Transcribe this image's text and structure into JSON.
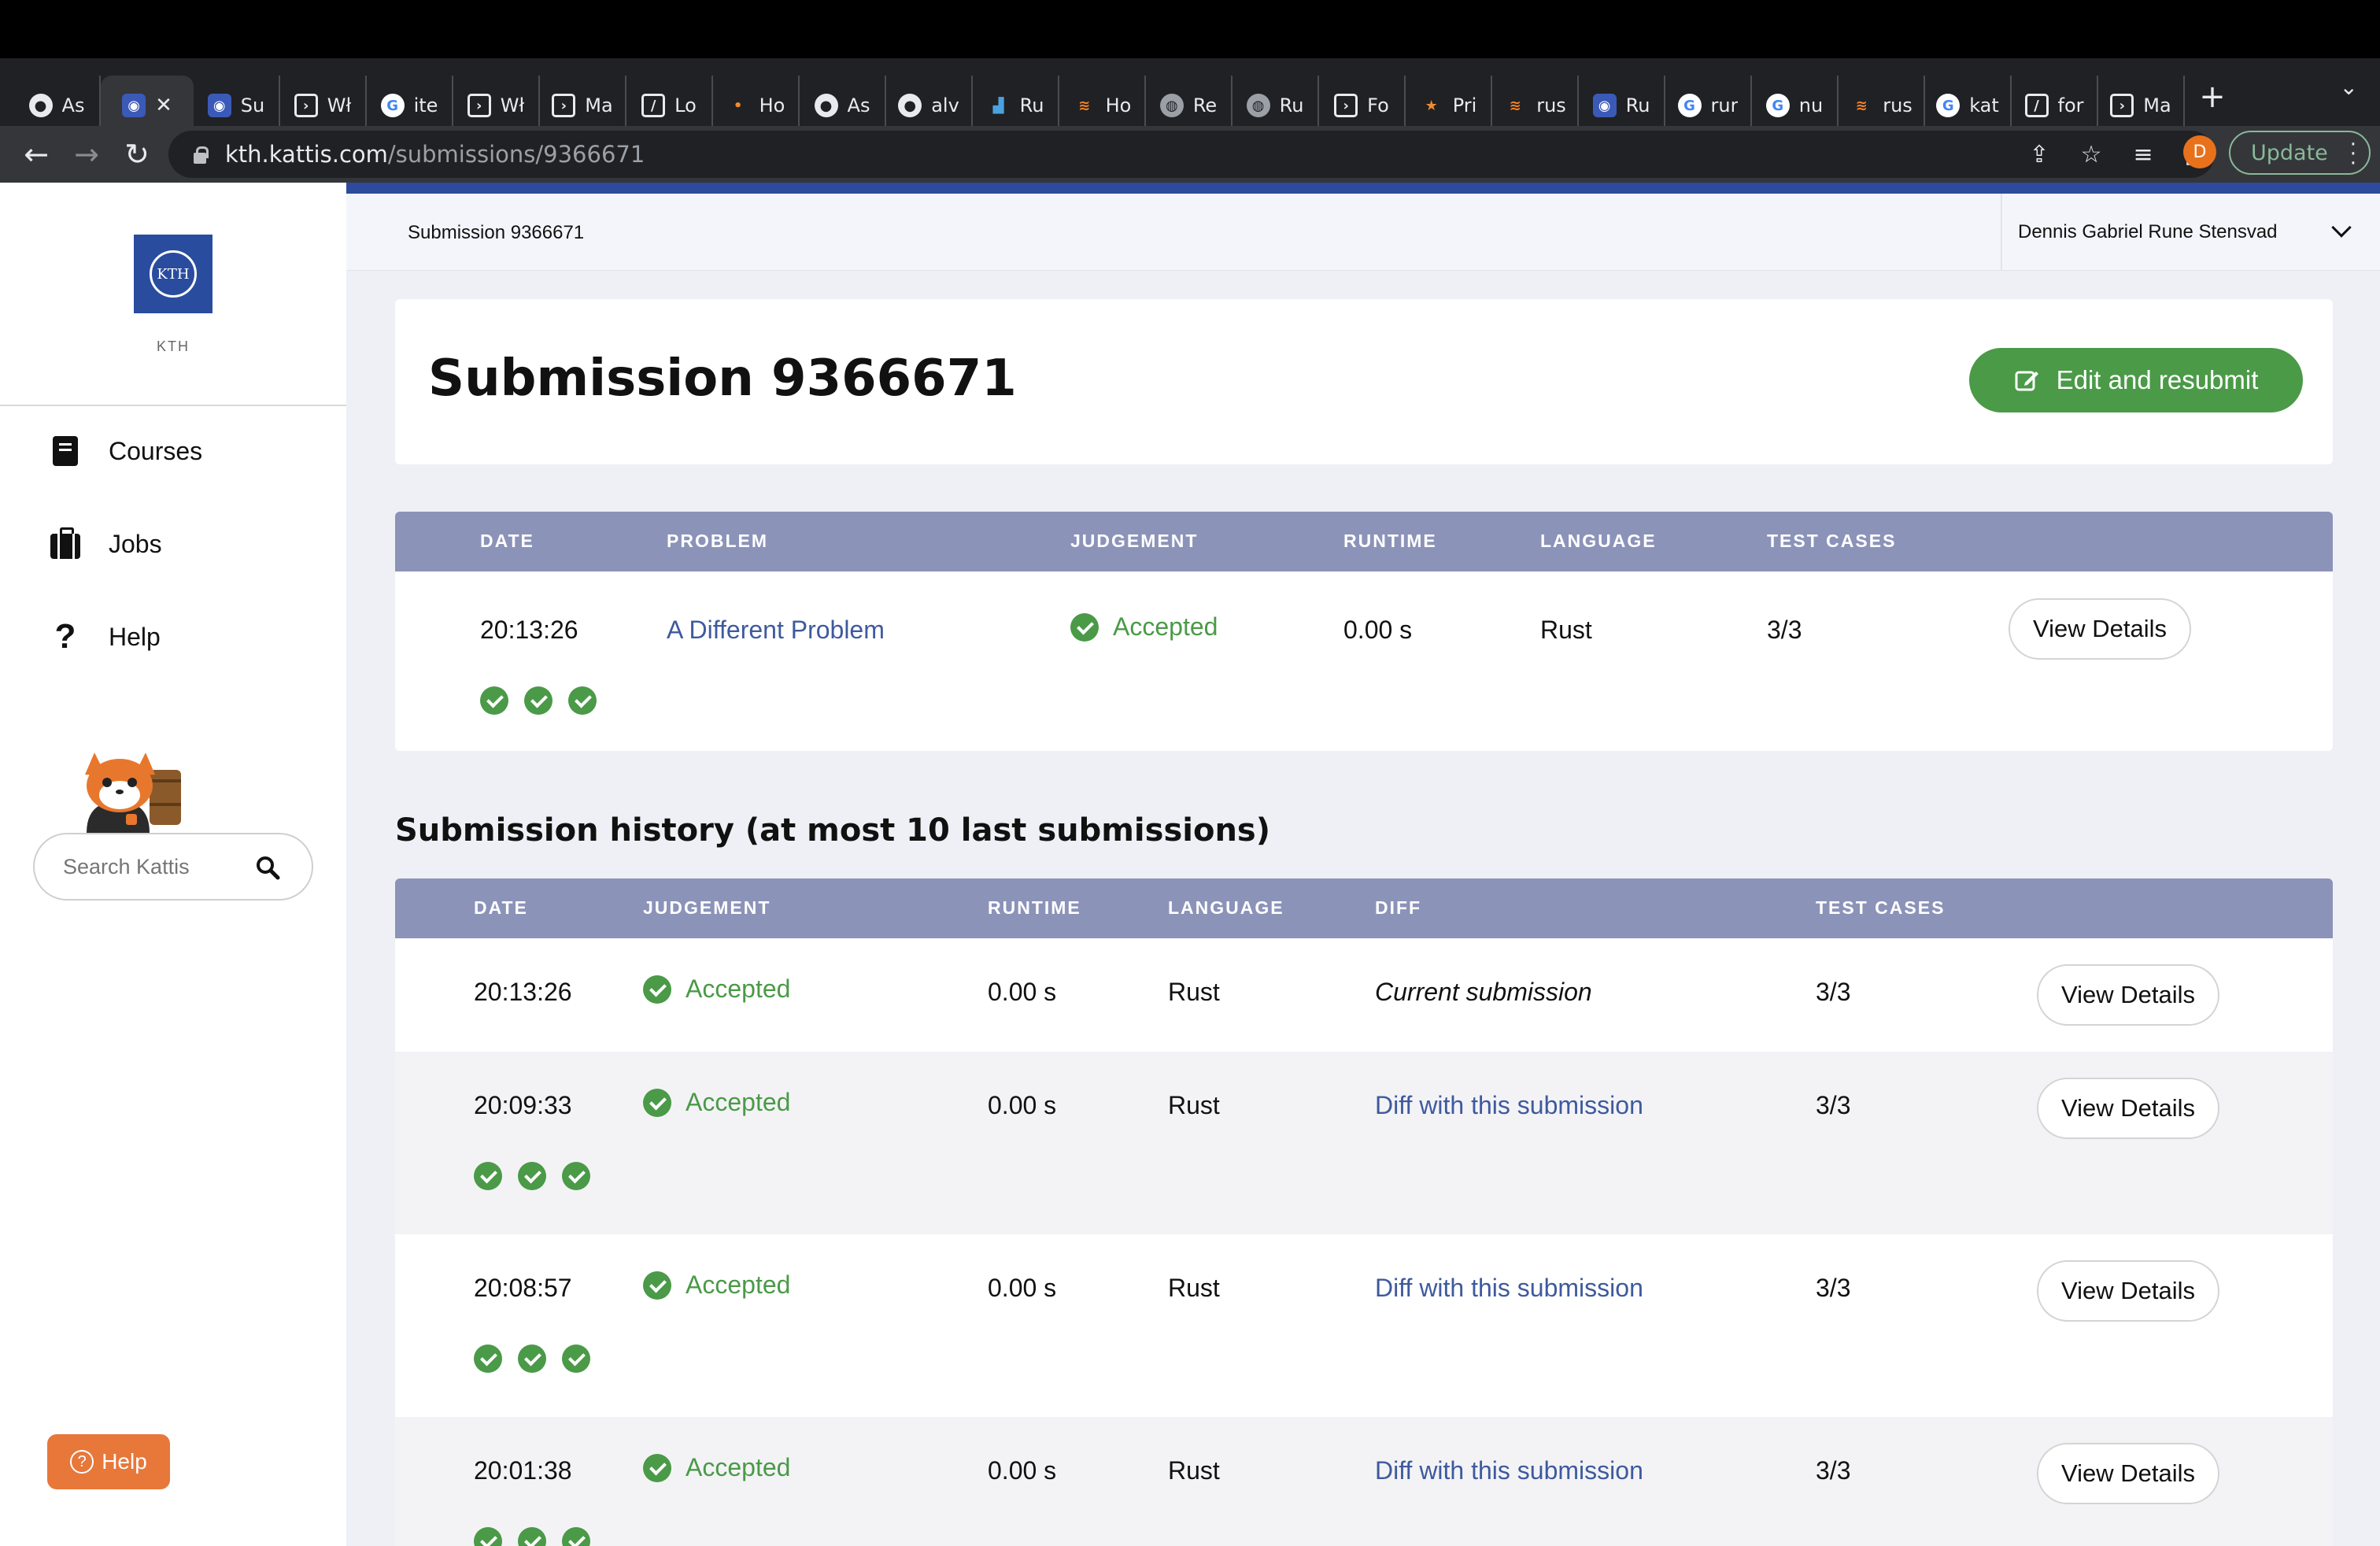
{
  "browser": {
    "tabs": [
      {
        "label": "As",
        "icon": "github-icon",
        "fav": "gh"
      },
      {
        "label": "",
        "icon": "kth-icon",
        "fav": "kth",
        "active": true
      },
      {
        "label": "Su",
        "icon": "kth-icon",
        "fav": "kth"
      },
      {
        "label": "Wł",
        "icon": "terminal-icon",
        "fav": "term"
      },
      {
        "label": "ite",
        "icon": "google-icon",
        "fav": "g"
      },
      {
        "label": "Wł",
        "icon": "terminal-icon",
        "fav": "term"
      },
      {
        "label": "Ma",
        "icon": "terminal-icon",
        "fav": "term"
      },
      {
        "label": "Lo",
        "icon": "notes-icon",
        "fav": "note"
      },
      {
        "label": "Ho",
        "icon": "dot-icon",
        "fav": "dot"
      },
      {
        "label": "As",
        "icon": "github-icon",
        "fav": "gh"
      },
      {
        "label": "alv",
        "icon": "github-icon",
        "fav": "gh"
      },
      {
        "label": "Ru",
        "icon": "chart-icon",
        "fav": "chart"
      },
      {
        "label": "Ho",
        "icon": "stackoverflow-icon",
        "fav": "so"
      },
      {
        "label": "Re",
        "icon": "rust-icon",
        "fav": "globe"
      },
      {
        "label": "Ru",
        "icon": "globe-icon",
        "fav": "globe"
      },
      {
        "label": "Fo",
        "icon": "terminal-icon",
        "fav": "term"
      },
      {
        "label": "Pri",
        "icon": "star-icon",
        "fav": "star"
      },
      {
        "label": "rus",
        "icon": "stackoverflow-icon",
        "fav": "so"
      },
      {
        "label": "Ru",
        "icon": "kth-icon",
        "fav": "kth"
      },
      {
        "label": "rur",
        "icon": "google-icon",
        "fav": "g"
      },
      {
        "label": "nu",
        "icon": "google-icon",
        "fav": "g"
      },
      {
        "label": "rus",
        "icon": "stackoverflow-icon",
        "fav": "so"
      },
      {
        "label": "kat",
        "icon": "google-icon",
        "fav": "g"
      },
      {
        "label": "for",
        "icon": "notes-icon",
        "fav": "note"
      },
      {
        "label": "Ma",
        "icon": "terminal-icon",
        "fav": "term"
      }
    ],
    "url_domain": "kth.kattis.com",
    "url_path": "/submissions/9366671",
    "profile_initial": "D",
    "update_label": "Update"
  },
  "sidebar": {
    "logo_text": "KTH",
    "logo_label": "KTH",
    "items": [
      {
        "label": "Courses",
        "icon": "book-icon"
      },
      {
        "label": "Jobs",
        "icon": "briefcase-icon"
      },
      {
        "label": "Help",
        "icon": "question-icon"
      }
    ],
    "search_placeholder": "Search Kattis",
    "help_button": "Help"
  },
  "header": {
    "breadcrumb": "Submission 9366671",
    "user_name": "Dennis Gabriel Rune Stensvad"
  },
  "main": {
    "title": "Submission 9366671",
    "edit_button": "Edit and resubmit",
    "submission_table": {
      "headers": [
        "DATE",
        "PROBLEM",
        "JUDGEMENT",
        "RUNTIME",
        "LANGUAGE",
        "TEST CASES"
      ],
      "row": {
        "date": "20:13:26",
        "problem": "A Different Problem",
        "judgement": "Accepted",
        "runtime": "0.00 s",
        "language": "Rust",
        "test_cases": "3/3",
        "passed_tests": 3,
        "button": "View Details"
      }
    },
    "history_title": "Submission history (at most 10 last submissions)",
    "history_table": {
      "headers": [
        "DATE",
        "JUDGEMENT",
        "RUNTIME",
        "LANGUAGE",
        "DIFF",
        "TEST CASES"
      ],
      "rows": [
        {
          "date": "20:13:26",
          "judgement": "Accepted",
          "runtime": "0.00 s",
          "language": "Rust",
          "diff": "Current submission",
          "test_cases": "3/3",
          "passed_tests": 0,
          "button": "View Details"
        },
        {
          "date": "20:09:33",
          "judgement": "Accepted",
          "runtime": "0.00 s",
          "language": "Rust",
          "diff": "Diff with this submission",
          "test_cases": "3/3",
          "passed_tests": 3,
          "button": "View Details"
        },
        {
          "date": "20:08:57",
          "judgement": "Accepted",
          "runtime": "0.00 s",
          "language": "Rust",
          "diff": "Diff with this submission",
          "test_cases": "3/3",
          "passed_tests": 3,
          "button": "View Details"
        },
        {
          "date": "20:01:38",
          "judgement": "Accepted",
          "runtime": "0.00 s",
          "language": "Rust",
          "diff": "Diff with this submission",
          "test_cases": "3/3",
          "passed_tests": 3,
          "button": "View Details"
        }
      ]
    }
  },
  "colors": {
    "accent_green": "#4a9a47",
    "table_header": "#8c93b9",
    "link_blue": "#3e5a9e",
    "header_accent": "#2e4a9e",
    "help_orange": "#e8773a"
  }
}
